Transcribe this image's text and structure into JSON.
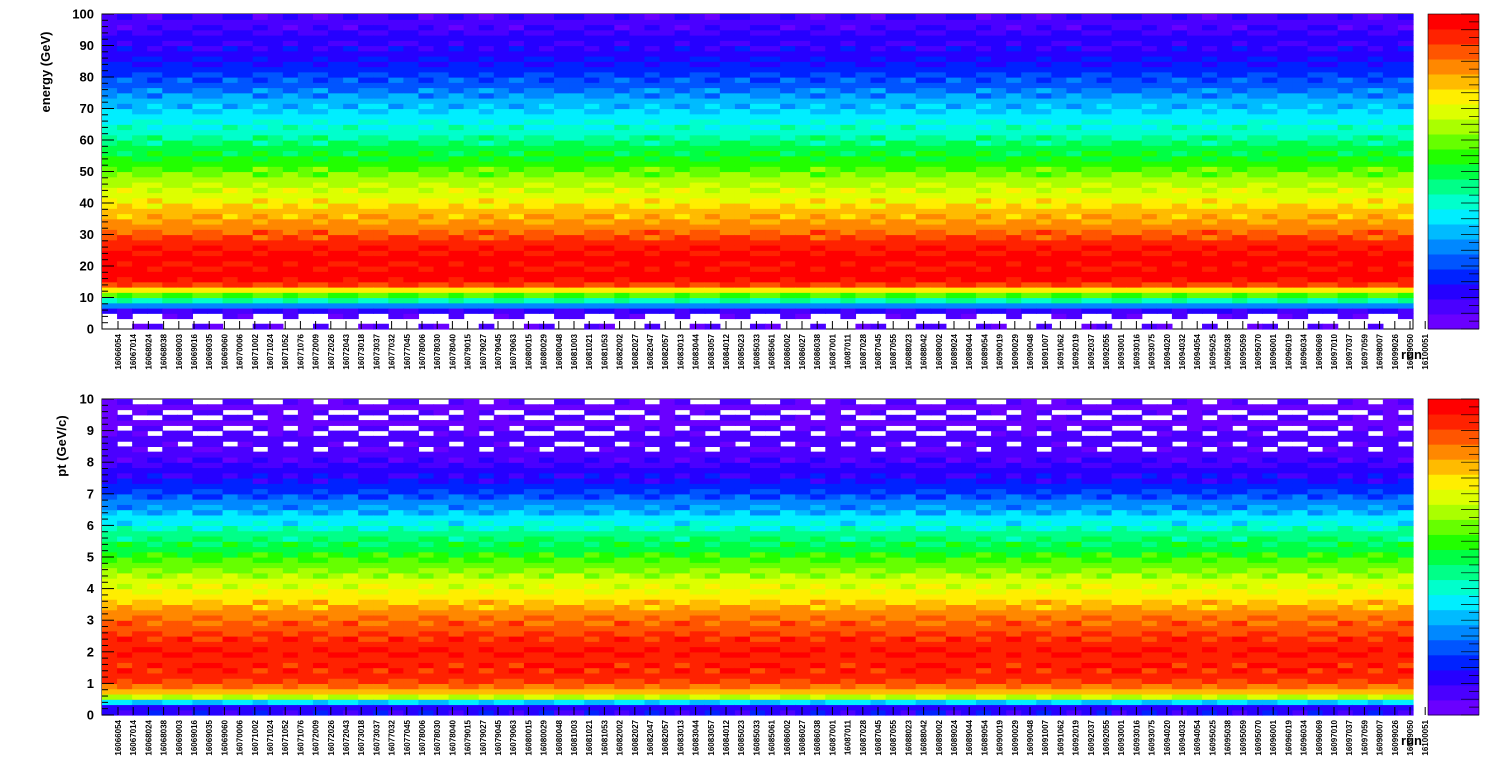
{
  "palette": [
    "#6a00ff",
    "#4a00ff",
    "#2600ff",
    "#0022ff",
    "#0055ff",
    "#0088ff",
    "#00bbff",
    "#00eeff",
    "#00ffcc",
    "#00ff88",
    "#00ff44",
    "#22ff00",
    "#66ff00",
    "#aaff00",
    "#ddff00",
    "#ffee00",
    "#ffbb00",
    "#ff8800",
    "#ff5500",
    "#ff2200",
    "#ff0000"
  ],
  "run_labels": [
    "16066054",
    "16067014",
    "16068024",
    "16068038",
    "16069003",
    "16069016",
    "16069035",
    "16069060",
    "16070006",
    "16071002",
    "16071024",
    "16071052",
    "16071076",
    "16072009",
    "16072026",
    "16072043",
    "16073018",
    "16073037",
    "16077032",
    "16077045",
    "16078006",
    "16078030",
    "16078040",
    "16079015",
    "16079027",
    "16079045",
    "16079063",
    "16080015",
    "16080029",
    "16080048",
    "16081003",
    "16081021",
    "16081053",
    "16082002",
    "16082027",
    "16082047",
    "16082057",
    "16083013",
    "16083044",
    "16083057",
    "16084012",
    "16085023",
    "16085033",
    "16085061",
    "16086002",
    "16086027",
    "16086038",
    "16087001",
    "16087011",
    "16087028",
    "16087045",
    "16087055",
    "16088023",
    "16088042",
    "16089002",
    "16089024",
    "16089044",
    "16089054",
    "16090019",
    "16090029",
    "16090048",
    "16091007",
    "16091062",
    "16092019",
    "16092037",
    "16092055",
    "16093001",
    "16093016",
    "16093075",
    "16094020",
    "16094032",
    "16094054",
    "16095025",
    "16095038",
    "16095059",
    "16095070",
    "16096001",
    "16096019",
    "16096034",
    "16096069",
    "16097010",
    "16097037",
    "16097059",
    "16098007",
    "16099026",
    "16099050",
    "16100051"
  ],
  "chart_data": [
    {
      "type": "heatmap",
      "title": "",
      "xlabel": "run",
      "ylabel": "energy (GeV)",
      "ylim": [
        0,
        100
      ],
      "yticks": [
        0,
        10,
        20,
        30,
        40,
        50,
        60,
        70,
        80,
        90,
        100
      ],
      "x_categories_key": "run_labels",
      "profile_y": [
        5,
        15,
        25,
        35,
        45,
        55,
        65,
        75,
        85,
        95
      ],
      "profile_level": [
        0.0,
        1.0,
        0.98,
        0.82,
        0.68,
        0.52,
        0.38,
        0.25,
        0.12,
        0.06
      ],
      "colorbar": true,
      "legend": "right colorbar"
    },
    {
      "type": "heatmap",
      "title": "",
      "xlabel": "run",
      "ylabel": "pt (GeV/c)",
      "ylim": [
        0,
        10
      ],
      "yticks": [
        0,
        1,
        2,
        3,
        4,
        5,
        6,
        7,
        8,
        9,
        10
      ],
      "x_categories_key": "run_labels",
      "profile_y": [
        0.3,
        0.6,
        1.0,
        1.5,
        2.0,
        2.5,
        3.0,
        3.5,
        4.0,
        4.5,
        5.0,
        5.5,
        6.0,
        6.5,
        7.0,
        7.5,
        8.0,
        8.5,
        9.0,
        9.5
      ],
      "profile_level": [
        0.1,
        0.7,
        0.92,
        0.96,
        0.97,
        0.94,
        0.88,
        0.8,
        0.72,
        0.64,
        0.56,
        0.48,
        0.38,
        0.28,
        0.18,
        0.1,
        0.06,
        0.03,
        0.02,
        0.01
      ],
      "colorbar": true,
      "legend": "right colorbar"
    }
  ]
}
